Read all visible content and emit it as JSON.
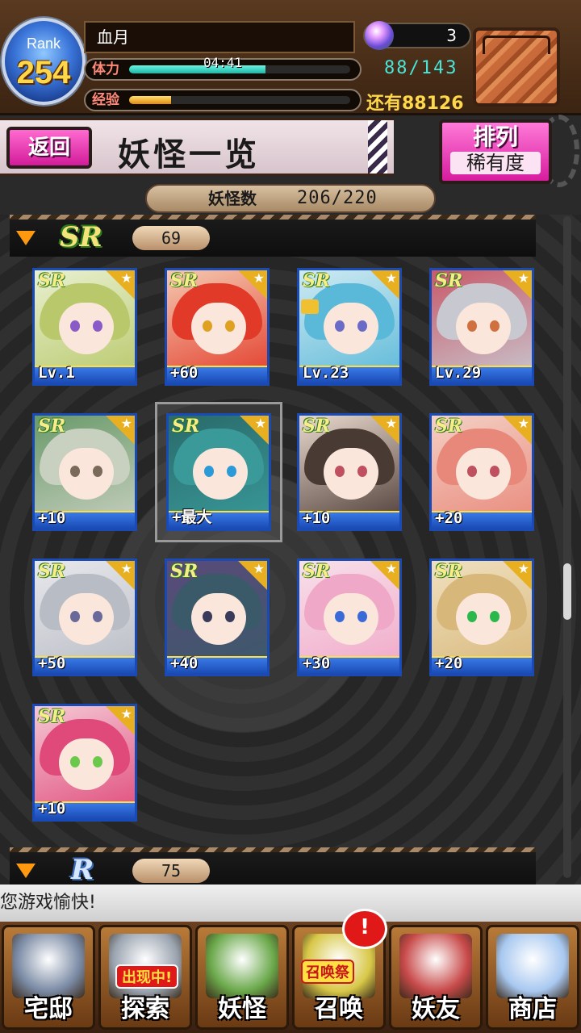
{
  "player": {
    "rank_label": "Rank",
    "rank": "254",
    "name": "血月",
    "stamina_label": "体力",
    "stamina_timer": "04:41",
    "stamina_value": "88/143",
    "stamina_fraction": 0.615,
    "exp_label": "经验",
    "exp_fraction": 0.19,
    "exp_remaining": "还有88126",
    "gems": "3"
  },
  "header": {
    "back_label": "返回",
    "title": "妖怪一览",
    "sort_title": "排列",
    "sort_value": "稀有度"
  },
  "count": {
    "label": "妖怪数",
    "value": "206/220"
  },
  "sections": [
    {
      "rarity": "SR",
      "count": "69"
    },
    {
      "rarity": "R",
      "count": "75"
    }
  ],
  "cards": [
    {
      "badge": "SR",
      "level": "Lv.1",
      "hair": "#b8c86a",
      "bg": "#e8f0d0",
      "eye": "#8a5ac8"
    },
    {
      "badge": "SR",
      "level": "+60",
      "hair": "#e23a28",
      "bg": "#f4c8b0",
      "eye": "#e0a020"
    },
    {
      "badge": "SR",
      "level": "Lv.23",
      "hair": "#5ab8d8",
      "bg": "#cfeaf2",
      "eye": "#6a6ac8",
      "locked": true
    },
    {
      "badge": "SR",
      "level": "Lv.29",
      "hair": "#c8c8d0",
      "bg": "#c85a6a",
      "eye": "#d07040"
    },
    {
      "badge": "SR",
      "level": "+10",
      "hair": "#c8d0c0",
      "bg": "#6a9a6a",
      "eye": "#7a6a5a"
    },
    {
      "badge": "SR",
      "level": "+最大",
      "hair": "#3a9a9a",
      "bg": "#2a6a6a",
      "eye": "#2a9ad8"
    },
    {
      "badge": "SR",
      "level": "+10",
      "hair": "#4a3a34",
      "bg": "#e8d8cc",
      "eye": "#c05060"
    },
    {
      "badge": "SR",
      "level": "+20",
      "hair": "#e8887a",
      "bg": "#f4d0c4",
      "eye": "#c05060"
    },
    {
      "badge": "SR",
      "level": "+50",
      "hair": "#b8bcc4",
      "bg": "#e8e8ec",
      "eye": "#6a6a9a"
    },
    {
      "badge": "SR",
      "level": "+40",
      "hair": "#3a5a6a",
      "bg": "#5a4a7a",
      "eye": "#3a3a5a"
    },
    {
      "badge": "SR",
      "level": "+30",
      "hair": "#f0a8c8",
      "bg": "#f8e0ea",
      "eye": "#3a6ad8"
    },
    {
      "badge": "SR",
      "level": "+20",
      "hair": "#d8b87a",
      "bg": "#f0e0c0",
      "eye": "#2ab84a"
    },
    {
      "badge": "SR",
      "level": "+10",
      "hair": "#e04a7a",
      "bg": "#f4c8d4",
      "eye": "#6ac84a"
    }
  ],
  "ticker": "您游戏愉快!",
  "nav": [
    {
      "label": "宅邸",
      "art": "#7a8aa4"
    },
    {
      "label": "探索",
      "art": "#9aa4b0",
      "badge": "出现中!"
    },
    {
      "label": "妖怪",
      "art": "#6aa84a"
    },
    {
      "label": "召唤",
      "art": "#d8c848",
      "badge": "召唤祭"
    },
    {
      "label": "妖友",
      "art": "#c84a4a"
    },
    {
      "label": "商店",
      "art": "#a8c8f0"
    }
  ],
  "nav_alert": "!",
  "colors": {
    "accent_pink": "#d21c9a",
    "stamina_teal": "#49e6d8",
    "exp_gold": "#ffd84a",
    "card_border": "#1a4ab4"
  }
}
